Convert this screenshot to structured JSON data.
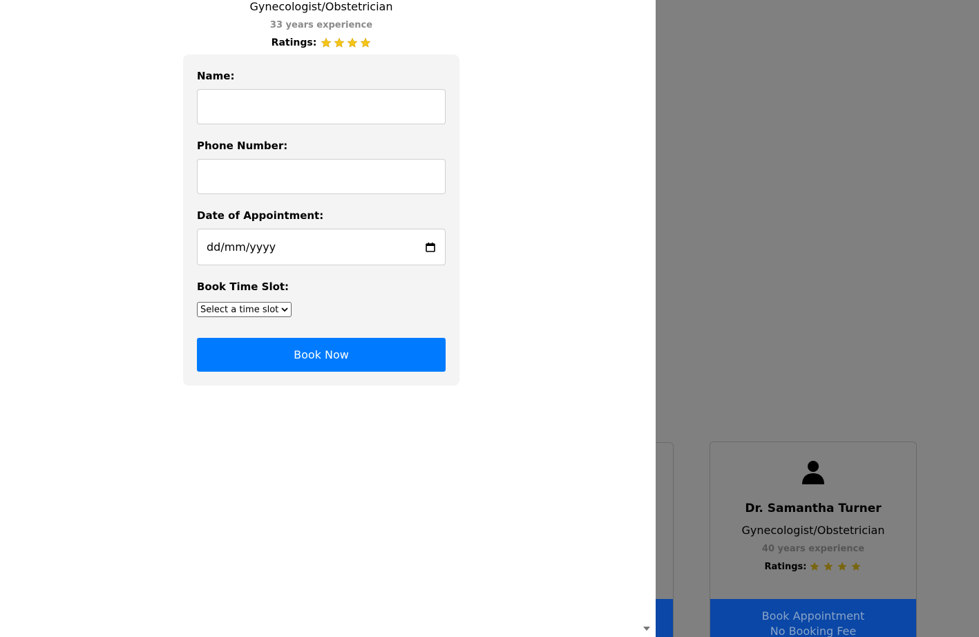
{
  "background_card": {
    "name": "Dr. Samantha Turner",
    "specialty": "Gynecologist/Obstetrician",
    "experience": "40 years experience",
    "ratings_label": "Ratings:",
    "stars": 4,
    "book_label_line1": "Book Appointment",
    "book_label_line2": "No Booking Fee"
  },
  "modal": {
    "specialty": "Gynecologist/Obstetrician",
    "experience": "33 years experience",
    "ratings_label": "Ratings:",
    "stars": 4,
    "form": {
      "name_label": "Name:",
      "name_value": "",
      "phone_label": "Phone Number:",
      "phone_value": "",
      "date_label": "Date of Appointment:",
      "date_placeholder": "dd/mm/yyyy",
      "slot_label": "Book Time Slot:",
      "slot_selected": "Select a time slot",
      "submit_label": "Book Now"
    }
  },
  "colors": {
    "primary_button": "#007bff",
    "star": "#f5c518",
    "overlay": "#808080"
  },
  "icons": [
    "user-icon",
    "star-icon",
    "calendar-icon",
    "chevron-down-icon",
    "scroll-down-arrow-icon"
  ]
}
